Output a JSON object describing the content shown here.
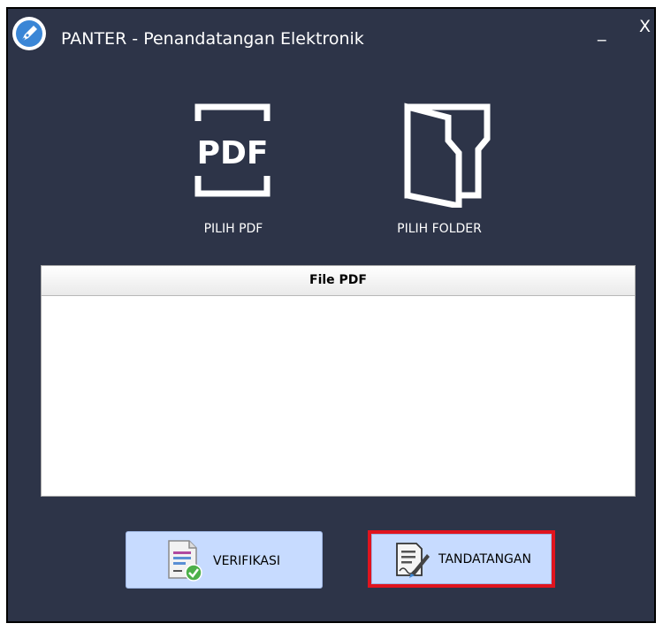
{
  "window": {
    "title": "PANTER - Penandatangan Elektronik",
    "minimize_label": "_",
    "close_label": "X",
    "logo_icon": "pen-nib-icon"
  },
  "pickers": {
    "pdf": {
      "icon": "pdf-file-icon",
      "icon_text": "PDF",
      "label": "PILIH PDF"
    },
    "folder": {
      "icon": "folder-icon",
      "label": "PILIH FOLDER"
    }
  },
  "file_table": {
    "header": "File PDF",
    "rows": []
  },
  "actions": {
    "verify": {
      "label": "VERIFIKASI",
      "icon": "verified-document-icon"
    },
    "sign": {
      "label": "TANDATANGAN",
      "icon": "signed-document-icon",
      "highlighted": true
    }
  },
  "colors": {
    "window_bg": "#2d3448",
    "button_bg": "#c7dbff",
    "highlight_border": "#e0141e",
    "text_light": "#ffffff"
  }
}
